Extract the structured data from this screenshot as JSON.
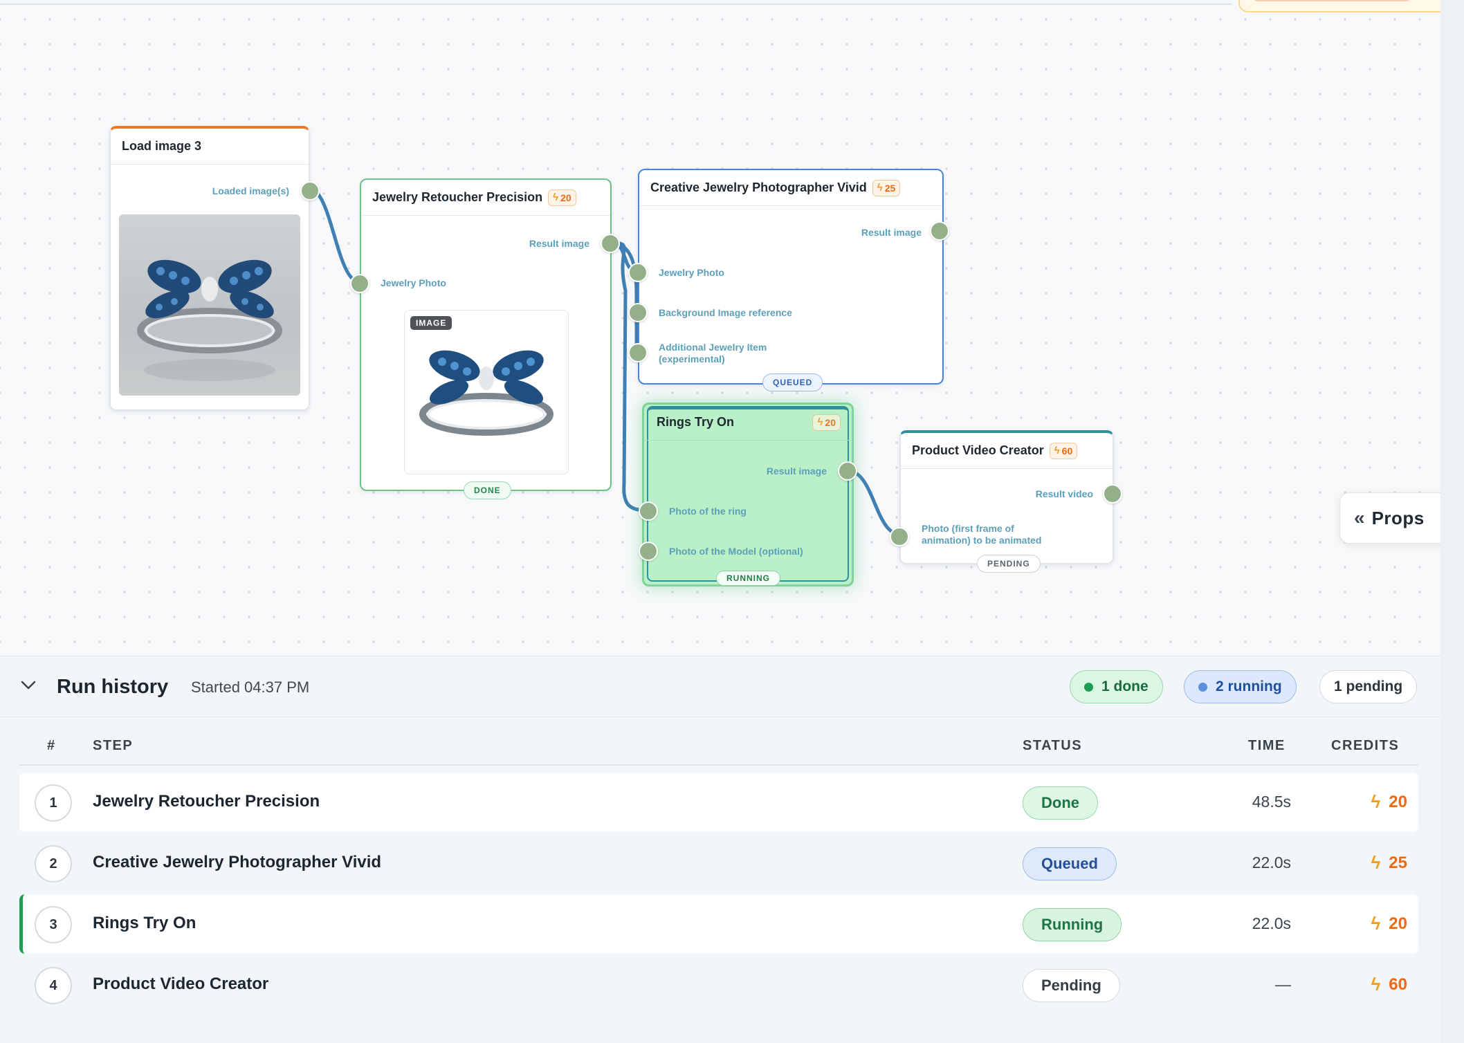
{
  "canvas": {
    "props_label": "Props",
    "nodes": {
      "load_image": {
        "title": "Load image 3",
        "output_label": "Loaded image(s)"
      },
      "retoucher": {
        "title": "Jewelry Retoucher Precision",
        "cost": "20",
        "output_label": "Result image",
        "input_label": "Jewelry Photo",
        "preview_tag": "IMAGE",
        "status": "DONE"
      },
      "photographer": {
        "title": "Creative Jewelry Photographer Vivid",
        "cost": "25",
        "output_label": "Result image",
        "input_1": "Jewelry Photo",
        "input_2": "Background Image reference",
        "input_3_line1": "Additional Jewelry Item",
        "input_3_line2": "(experimental)",
        "status": "QUEUED"
      },
      "rings": {
        "title": "Rings Try On",
        "cost": "20",
        "output_label": "Result image",
        "input_1": "Photo of the ring",
        "input_2": "Photo of the Model (optional)",
        "status": "RUNNING"
      },
      "video": {
        "title": "Product Video Creator",
        "cost": "60",
        "output_label": "Result video",
        "input_line1": "Photo (first frame of",
        "input_line2": "animation) to be animated",
        "status": "PENDING"
      }
    },
    "colors": {
      "wire": "#3f7fb3",
      "port": "#93b08a",
      "load_accent": "#e87a2a",
      "done_border": "#6dc08a",
      "queued_border": "#4a86d8",
      "running_fill": "#baf0c8",
      "video_accent": "#2f8f9d"
    }
  },
  "run_history": {
    "title": "Run history",
    "started": "Started 04:37 PM",
    "summary": {
      "done": "1 done",
      "running": "2 running",
      "pending": "1 pending"
    },
    "columns": {
      "num": "#",
      "step": "STEP",
      "status": "STATUS",
      "time": "TIME",
      "credits": "CREDITS"
    },
    "rows": [
      {
        "num": "1",
        "step": "Jewelry Retoucher Precision",
        "status": "Done",
        "time": "48.5s",
        "credits": "20"
      },
      {
        "num": "2",
        "step": "Creative Jewelry Photographer Vivid",
        "status": "Queued",
        "time": "22.0s",
        "credits": "25"
      },
      {
        "num": "3",
        "step": "Rings Try On",
        "status": "Running",
        "time": "22.0s",
        "credits": "20"
      },
      {
        "num": "4",
        "step": "Product Video Creator",
        "status": "Pending",
        "time": "—",
        "credits": "60"
      }
    ]
  }
}
